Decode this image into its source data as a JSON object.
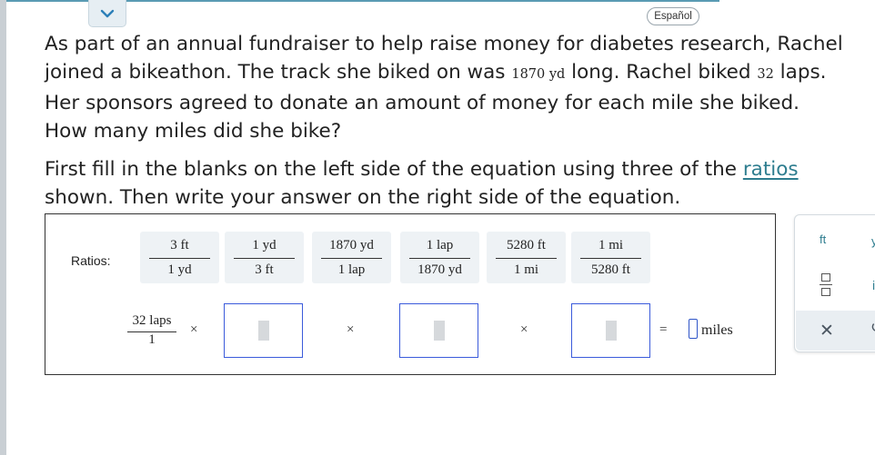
{
  "header": {
    "espanol_label": "Español"
  },
  "question": {
    "part1": "As part of an annual fundraiser to help raise money for diabetes research, Rachel joined a bikeathon. The track she biked on was ",
    "track_length": "1870 yd",
    "part2": " long. Rachel biked ",
    "laps": "32",
    "part3": " laps. Her sponsors agreed to donate an amount of money for each mile she biked. How many miles did she bike?"
  },
  "instructions": {
    "part1": "First fill in the blanks on the left side of the equation using three of the ",
    "link": "ratios",
    "part2": " shown. Then write your answer on the right side of the equation."
  },
  "ratios_label": "Ratios:",
  "ratios": [
    {
      "num": "3 ft",
      "den": "1 yd"
    },
    {
      "num": "1 yd",
      "den": "3 ft"
    },
    {
      "num": "1870 yd",
      "den": "1 lap"
    },
    {
      "num": "1 lap",
      "den": "1870 yd"
    },
    {
      "num": "5280 ft",
      "den": "1 mi"
    },
    {
      "num": "1 mi",
      "den": "5280 ft"
    }
  ],
  "equation": {
    "given_num": "32 laps",
    "given_den": "1",
    "times": "×",
    "equals": "=",
    "answer_unit": "miles"
  },
  "toolbar": {
    "unit_ft": "ft",
    "unit_partial": "y",
    "partial_i": "i",
    "clear": "✕",
    "undo": "↺"
  }
}
